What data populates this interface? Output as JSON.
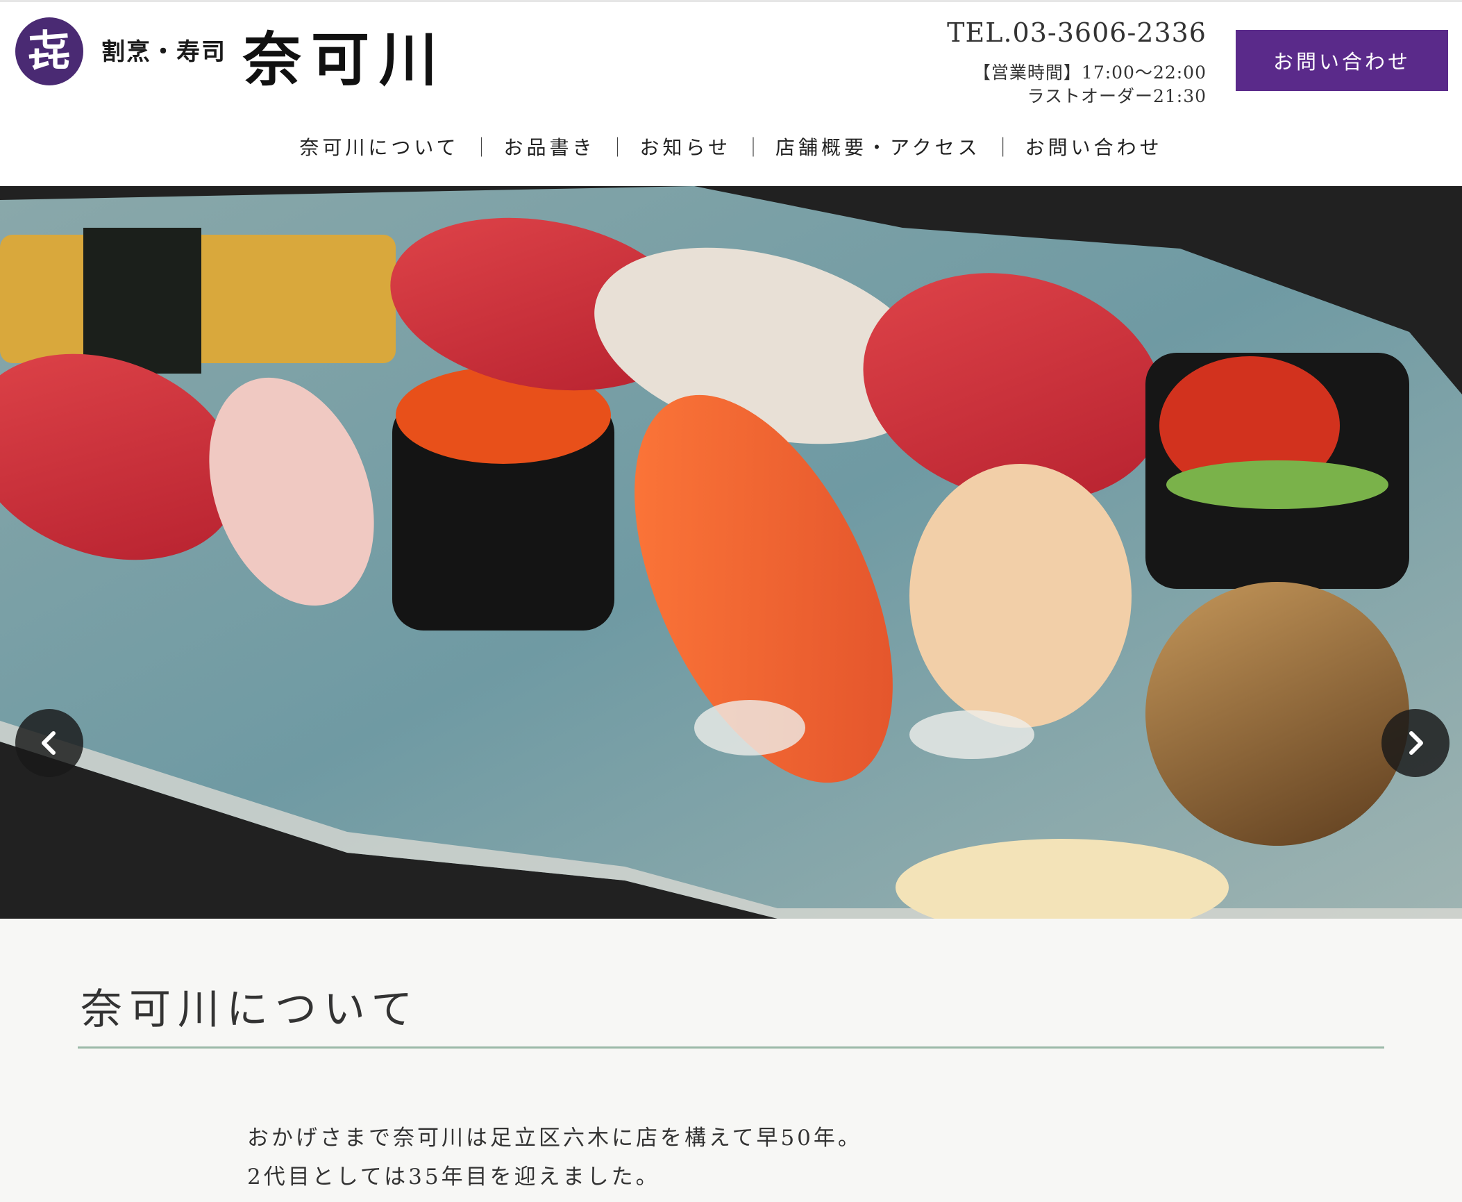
{
  "header": {
    "logo_mark": "㐂",
    "logo_sub": "割烹・寿司",
    "logo_main": "奈可川",
    "tel": "TEL.03-3606-2336",
    "hours": "【営業時間】17:00〜22:00",
    "last_order": "ラストオーダー21:30",
    "contact_button": "お問い合わせ"
  },
  "nav": {
    "items": [
      "奈可川について",
      "お品書き",
      "お知らせ",
      "店舗概要・アクセス",
      "お問い合わせ"
    ],
    "separator": "｜"
  },
  "slider": {
    "slides": 5,
    "active_index": 0,
    "prev_icon": "chevron-left-icon",
    "next_icon": "chevron-right-icon"
  },
  "about": {
    "heading": "奈可川について",
    "paragraphs": [
      "おかげさまで奈可川は足立区六木に店を構えて早50年。",
      "2代目としては35年目を迎えました。"
    ]
  },
  "colors": {
    "brand_purple": "#5a2a8a",
    "logo_purple": "#4a2a73",
    "rule_green": "#9bb9a8",
    "section_bg": "#f7f7f5"
  }
}
